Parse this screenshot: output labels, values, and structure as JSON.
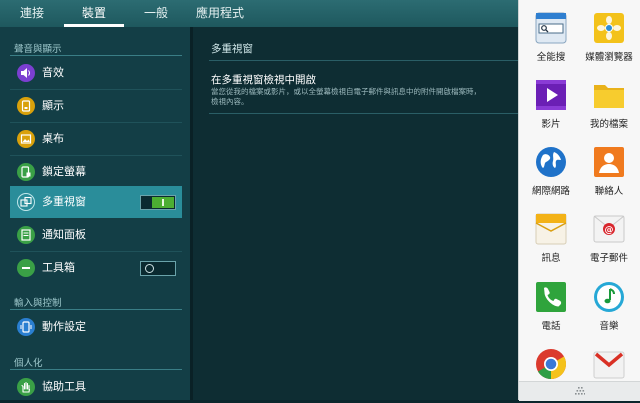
{
  "tabs": [
    {
      "label": "連接",
      "active": false
    },
    {
      "label": "裝置",
      "active": true
    },
    {
      "label": "一般",
      "active": false
    },
    {
      "label": "應用程式",
      "active": false
    }
  ],
  "sidebar": {
    "sections": [
      {
        "header": "聲音與顯示"
      },
      {
        "header": "輸入與控制"
      },
      {
        "header": "個人化"
      }
    ],
    "items": [
      {
        "label": "音效",
        "icon": "speaker-icon",
        "color": "#7b3fd1"
      },
      {
        "label": "顯示",
        "icon": "display-icon",
        "color": "#d9a10b"
      },
      {
        "label": "桌布",
        "icon": "wallpaper-icon",
        "color": "#d9a10b"
      },
      {
        "label": "鎖定螢幕",
        "icon": "lock-screen-icon",
        "color": "#3aa046"
      },
      {
        "label": "多重視窗",
        "icon": "multi-window-icon",
        "color": "#2a8d9a",
        "toggle": "on"
      },
      {
        "label": "通知面板",
        "icon": "notification-panel-icon",
        "color": "#3aa046"
      },
      {
        "label": "工具箱",
        "icon": "toolbox-icon",
        "color": "#3aa046",
        "toggle": "off"
      },
      {
        "label": "動作設定",
        "icon": "motion-icon",
        "color": "#2a7fd1"
      },
      {
        "label": "協助工具",
        "icon": "hand-icon",
        "color": "#3aa046"
      }
    ]
  },
  "main": {
    "title": "多重視窗",
    "option_title": "在多重視窗檢視中開啟",
    "option_desc": "當您從我的檔案或影片，或以全螢幕檢視自電子郵件與訊息中的附件開啟檔案時，\n檢視內容。"
  },
  "drawer": {
    "apps": [
      {
        "label": "全能搜",
        "icon": "search-app-icon"
      },
      {
        "label": "媒體瀏覽器",
        "icon": "media-browser-icon"
      },
      {
        "label": "影片",
        "icon": "video-icon"
      },
      {
        "label": "我的檔案",
        "icon": "folder-icon"
      },
      {
        "label": "網際網路",
        "icon": "globe-icon"
      },
      {
        "label": "聯絡人",
        "icon": "contacts-icon"
      },
      {
        "label": "訊息",
        "icon": "message-icon"
      },
      {
        "label": "電子郵件",
        "icon": "email-icon"
      },
      {
        "label": "電話",
        "icon": "phone-icon"
      },
      {
        "label": "音樂",
        "icon": "music-icon"
      },
      {
        "label": "",
        "icon": "chrome-icon"
      },
      {
        "label": "",
        "icon": "gmail-icon"
      }
    ]
  },
  "colors": {
    "accent": "#2a8d9a",
    "toggle_on": "#4cae32",
    "tabbar": "#2c6c72"
  }
}
